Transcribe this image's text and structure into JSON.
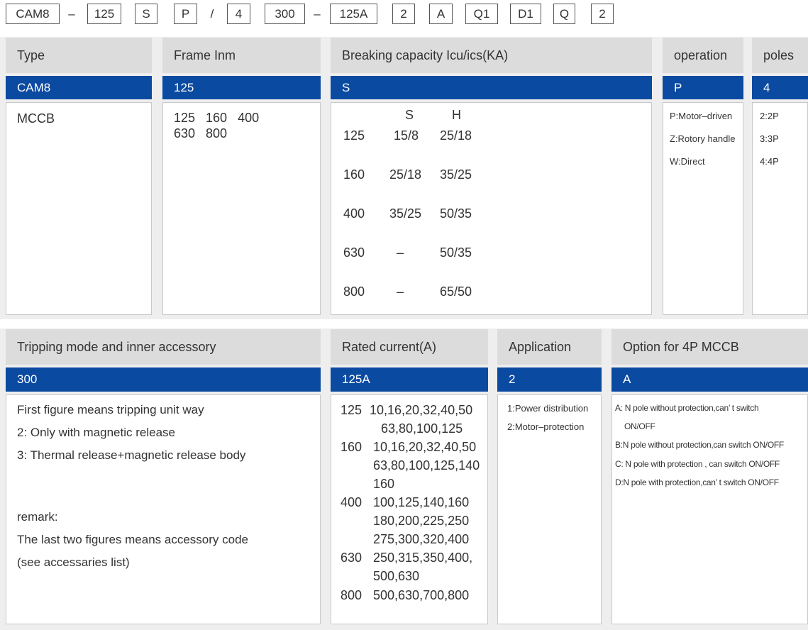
{
  "code_strip": [
    "CAM8",
    "–",
    "125",
    "S",
    "P",
    "/",
    "4",
    "300",
    "–",
    "125A",
    "2",
    "A",
    "Q1",
    "D1",
    "Q",
    "2"
  ],
  "top": {
    "headers": [
      "Type",
      "Frame Inm",
      "Breaking capacity Icu/ics(KA)",
      "operation",
      "poles"
    ],
    "selected": [
      "CAM8",
      "125",
      "S",
      "P",
      "4"
    ],
    "type_body": "MCCB",
    "frame_body": [
      "125   160   400",
      "630   800"
    ],
    "breaking": {
      "columns": [
        "S",
        "H"
      ],
      "rows": [
        {
          "frame": "125",
          "s": "15/8",
          "h": "25/18"
        },
        {
          "frame": "160",
          "s": "25/18",
          "h": "35/25"
        },
        {
          "frame": "400",
          "s": "35/25",
          "h": "50/35"
        },
        {
          "frame": "630",
          "s": "–",
          "h": "50/35"
        },
        {
          "frame": "800",
          "s": "–",
          "h": "65/50"
        }
      ]
    },
    "operation_body": [
      "P:Motor–driven",
      "Z:Rotory handle",
      "W:Direct"
    ],
    "poles_body": [
      "2:2P",
      "3:3P",
      "4:4P"
    ]
  },
  "bottom": {
    "headers": [
      "Tripping mode and inner accessory",
      "Rated current(A)",
      "Application",
      "Option for 4P MCCB"
    ],
    "selected": [
      "300",
      "125A",
      "2",
      "A"
    ],
    "tripping_body": [
      "First figure means tripping unit way",
      "2: Only with magnetic release",
      "3: Thermal release+magnetic release body"
    ],
    "remark_body": [
      "remark:",
      "The last two figures means accessory code",
      "(see accessaries list)"
    ],
    "rated_current": [
      {
        "frame": "125",
        "lines": [
          "10,16,20,32,40,50",
          "63,80,100,125"
        ]
      },
      {
        "frame": "160",
        "lines": [
          "10,16,20,32,40,50",
          "63,80,100,125,140",
          "160"
        ]
      },
      {
        "frame": "400",
        "lines": [
          "100,125,140,160",
          "180,200,225,250",
          "275,300,320,400"
        ]
      },
      {
        "frame": "630",
        "lines": [
          "250,315,350,400,",
          "500,630"
        ]
      },
      {
        "frame": "800",
        "lines": [
          "500,630,700,800"
        ]
      }
    ],
    "application_body": [
      "1:Power distribution",
      "2:Motor–protection"
    ],
    "option_body": [
      "A: N pole without protection,can’ t switch",
      "ON/OFF",
      "B:N pole without protection,can switch ON/OFF",
      "C: N pole with protection , can switch ON/OFF",
      "D:N pole with protection,can’ t switch ON/OFF"
    ]
  }
}
